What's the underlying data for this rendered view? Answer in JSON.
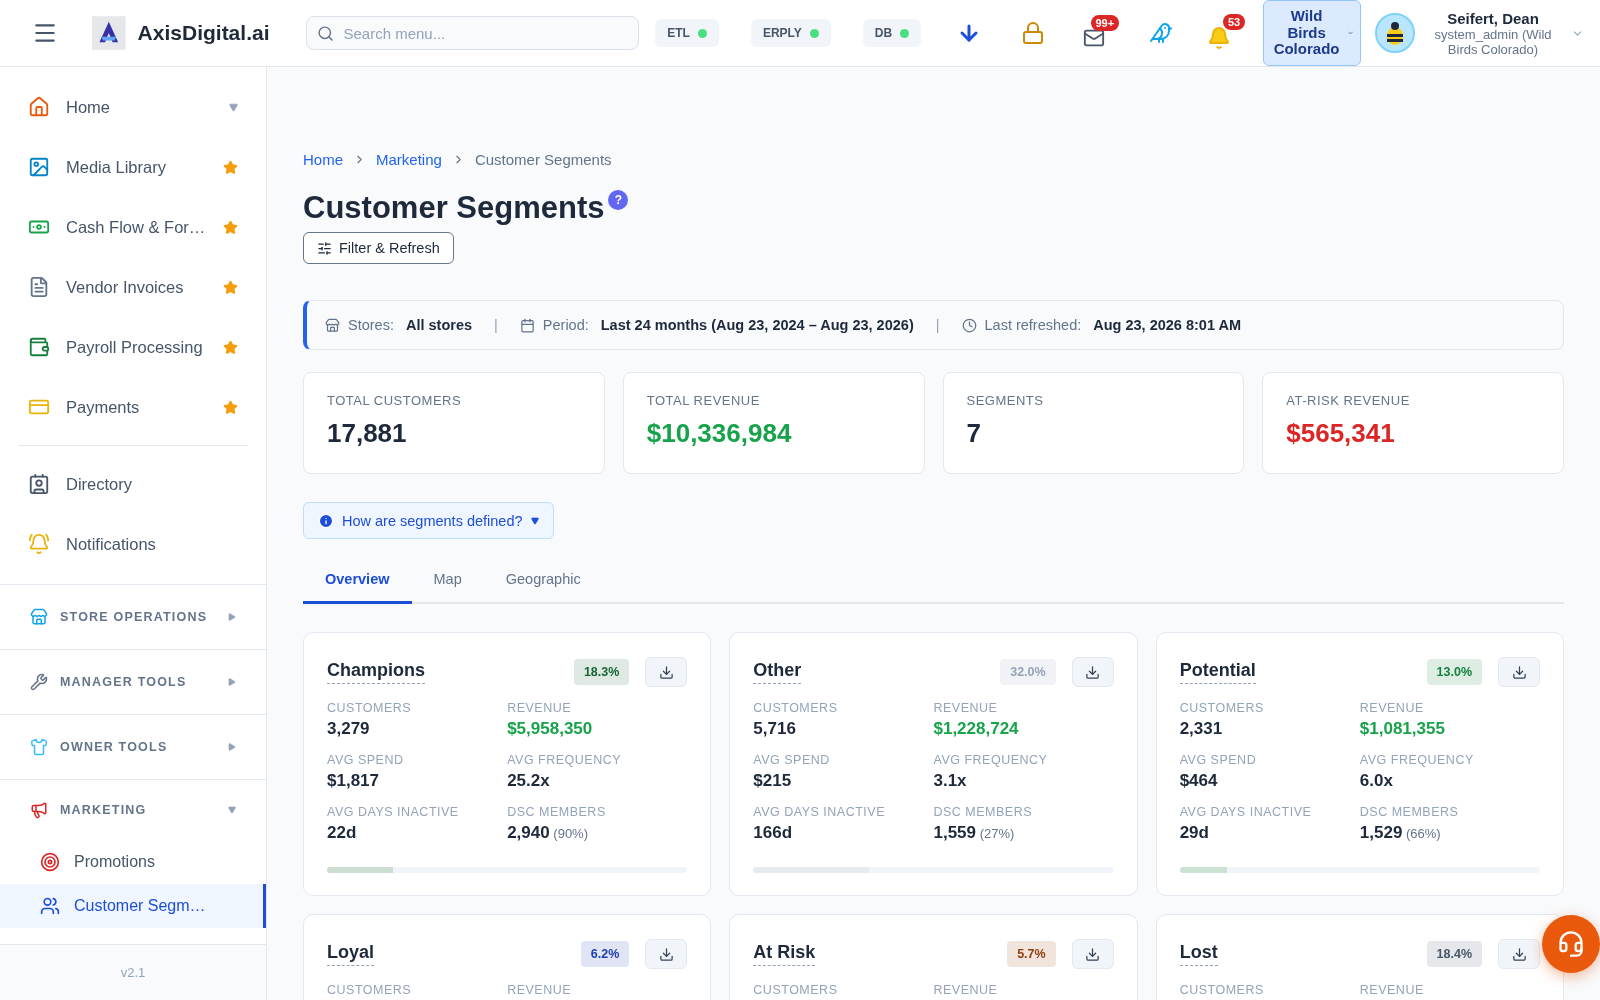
{
  "topbar": {
    "brand": "AxisDigital.ai",
    "search": {
      "placeholder": "Search menu..."
    },
    "status_chips": [
      {
        "label": "ETL",
        "online": true
      },
      {
        "label": "ERPLY",
        "online": true
      },
      {
        "label": "DB",
        "online": true
      }
    ],
    "mail_badge": "99+",
    "bell_badge": "53",
    "store": "Wild Birds Colorado",
    "user": {
      "name": "Seifert, Dean",
      "role": "system_admin (Wild Birds Colorado)"
    }
  },
  "sidebar": {
    "items": [
      {
        "label": "Home",
        "starred": false,
        "has_submenu": true
      },
      {
        "label": "Media Library",
        "starred": true
      },
      {
        "label": "Cash Flow & For…",
        "starred": true
      },
      {
        "label": "Vendor Invoices",
        "starred": true
      },
      {
        "label": "Payroll Processing",
        "starred": true
      },
      {
        "label": "Payments",
        "starred": true
      }
    ],
    "more_items": [
      {
        "label": "Directory"
      },
      {
        "label": "Notifications"
      }
    ],
    "sections": [
      {
        "label": "STORE OPERATIONS",
        "expanded": false
      },
      {
        "label": "MANAGER TOOLS",
        "expanded": false
      },
      {
        "label": "OWNER TOOLS",
        "expanded": false
      },
      {
        "label": "MARKETING",
        "expanded": true,
        "children": [
          {
            "label": "Promotions",
            "selected": false
          },
          {
            "label": "Customer Segm…",
            "selected": true
          }
        ]
      }
    ],
    "version": "v2.1"
  },
  "breadcrumb": [
    {
      "label": "Home",
      "link": true
    },
    {
      "label": "Marketing",
      "link": true
    },
    {
      "label": "Customer Segments",
      "link": false
    }
  ],
  "title": "Customer Segments",
  "help": "?",
  "filter_button": "Filter & Refresh",
  "info_bar": [
    {
      "label": "Stores:",
      "value": "All stores"
    },
    {
      "separator": "|",
      "label": "Period:",
      "value": "Last 24 months (Aug 23, 2024 – Aug 23, 2026)"
    },
    {
      "separator": "|",
      "label": "Last refreshed:",
      "value": "Aug 23, 2026 8:01 AM"
    }
  ],
  "stats": [
    {
      "label": "TOTAL CUSTOMERS",
      "value": "17,881",
      "color": "#1e293b"
    },
    {
      "label": "TOTAL REVENUE",
      "value": "$10,336,984",
      "color": "#16a34a"
    },
    {
      "label": "SEGMENTS",
      "value": "7",
      "color": "#1e293b"
    },
    {
      "label": "AT-RISK REVENUE",
      "value": "$565,341",
      "color": "#dc2626"
    }
  ],
  "definition_toggle": {
    "label": "How are segments defined?",
    "expanded": false
  },
  "tabs": [
    {
      "label": "Overview",
      "selected": true
    },
    {
      "label": "Map",
      "selected": false
    },
    {
      "label": "Geographic",
      "selected": false
    }
  ],
  "segments": [
    {
      "name": "Champions",
      "share": "18.3%",
      "color": "#166534",
      "level": 0.183,
      "metrics": [
        {
          "label": "CUSTOMERS",
          "value": "3,279"
        },
        {
          "label": "REVENUE",
          "value": "$5,958,350",
          "kind": "money"
        },
        {
          "label": "AVG SPEND",
          "value": "$1,817"
        },
        {
          "label": "AVG FREQUENCY",
          "value": "25.2x"
        },
        {
          "label": "AVG DAYS INACTIVE",
          "value": "22d"
        },
        {
          "label": "DSC MEMBERS",
          "value": "2,940",
          "note": "(90%)"
        }
      ]
    },
    {
      "name": "Other",
      "share": "32.0%",
      "color": "#94a3b8",
      "level": 0.32,
      "metrics": [
        {
          "label": "CUSTOMERS",
          "value": "5,716"
        },
        {
          "label": "REVENUE",
          "value": "$1,228,724",
          "kind": "money"
        },
        {
          "label": "AVG SPEND",
          "value": "$215"
        },
        {
          "label": "AVG FREQUENCY",
          "value": "3.1x"
        },
        {
          "label": "AVG DAYS INACTIVE",
          "value": "166d"
        },
        {
          "label": "DSC MEMBERS",
          "value": "1,559",
          "note": "(27%)"
        }
      ]
    },
    {
      "name": "Potential",
      "share": "13.0%",
      "color": "#15803d",
      "level": 0.13,
      "metrics": [
        {
          "label": "CUSTOMERS",
          "value": "2,331"
        },
        {
          "label": "REVENUE",
          "value": "$1,081,355",
          "kind": "money"
        },
        {
          "label": "AVG SPEND",
          "value": "$464"
        },
        {
          "label": "AVG FREQUENCY",
          "value": "6.0x"
        },
        {
          "label": "AVG DAYS INACTIVE",
          "value": "29d"
        },
        {
          "label": "DSC MEMBERS",
          "value": "1,529",
          "note": "(66%)"
        }
      ]
    },
    {
      "name": "Loyal",
      "share": "6.2%",
      "color": "#1e40af",
      "metrics": [
        {
          "label": "CUSTOMERS"
        },
        {
          "label": "REVENUE"
        }
      ]
    },
    {
      "name": "At Risk",
      "share": "5.7%",
      "color": "#92400e",
      "metrics": [
        {
          "label": "CUSTOMERS"
        },
        {
          "label": "REVENUE"
        }
      ]
    },
    {
      "name": "Lost",
      "share": "18.4%",
      "color": "#475569",
      "metrics": [
        {
          "label": "CUSTOMERS"
        },
        {
          "label": "REVENUE"
        }
      ]
    }
  ]
}
